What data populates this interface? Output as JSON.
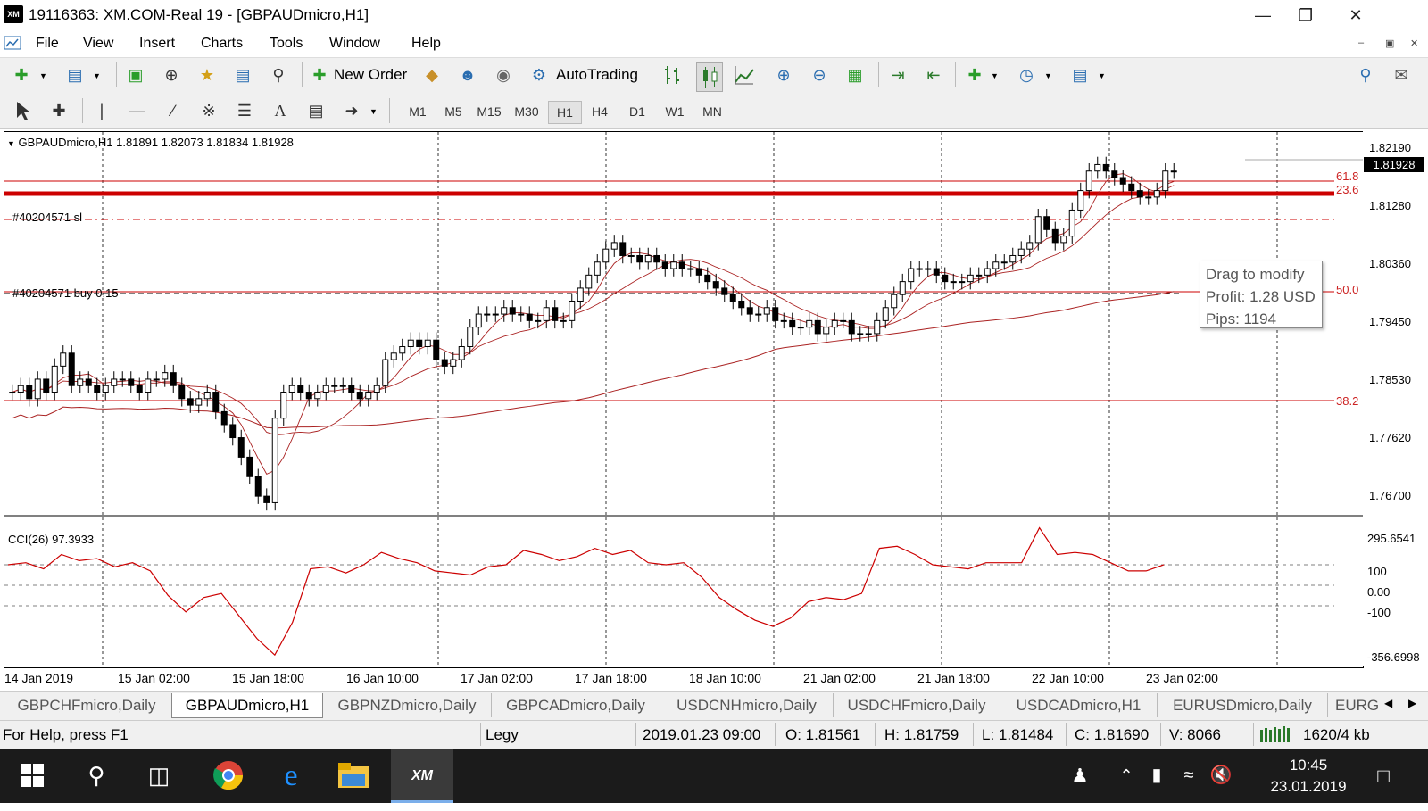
{
  "window": {
    "title": "19116363: XM.COM-Real 19 - [GBPAUDmicro,H1]",
    "app_icon_text": "XM"
  },
  "menu": [
    "File",
    "View",
    "Insert",
    "Charts",
    "Tools",
    "Window",
    "Help"
  ],
  "toolbar": {
    "new_order_label": "New Order",
    "autotrading_label": "AutoTrading"
  },
  "timeframes": [
    "M1",
    "M5",
    "M15",
    "M30",
    "H1",
    "H4",
    "D1",
    "W1",
    "MN"
  ],
  "active_timeframe": "H1",
  "chart": {
    "header": "GBPAUDmicro,H1  1.81891 1.82073 1.81834 1.81928",
    "current_price": "1.81928",
    "price_labels": [
      "1.82190",
      "1.81280",
      "1.80360",
      "1.79450",
      "1.78530",
      "1.77620",
      "1.76700"
    ],
    "annotations": {
      "sl_label": "#40204571 sl",
      "buy_label": "#40204571 buy 0.15"
    },
    "fib_levels": [
      "61.8",
      "23.6",
      "50.0",
      "38.2"
    ],
    "tooltip": [
      "Drag to modify",
      "Profit: 1.28 USD",
      "Pips: 1194"
    ],
    "indicator": {
      "label": "CCI(26) 97.3933",
      "axis_labels": [
        "295.6541",
        "100",
        "0.00",
        "-100",
        "-356.6998"
      ]
    },
    "time_labels": [
      "14 Jan 2019",
      "15 Jan 02:00",
      "15 Jan 18:00",
      "16 Jan 10:00",
      "17 Jan 02:00",
      "17 Jan 18:00",
      "18 Jan 10:00",
      "21 Jan 02:00",
      "21 Jan 18:00",
      "22 Jan 10:00",
      "23 Jan 02:00"
    ]
  },
  "chart_data": {
    "type": "candlestick",
    "symbol": "GBPAUDmicro",
    "timeframe": "H1",
    "ohlc_last": {
      "open": 1.81891,
      "high": 1.82073,
      "low": 1.81834,
      "close": 1.81928
    },
    "ylim": [
      1.766,
      1.825
    ],
    "close_series": [
      1.785,
      1.786,
      1.784,
      1.787,
      1.785,
      1.789,
      1.791,
      1.786,
      1.787,
      1.786,
      1.785,
      1.786,
      1.787,
      1.787,
      1.786,
      1.785,
      1.787,
      1.787,
      1.788,
      1.786,
      1.784,
      1.783,
      1.784,
      1.785,
      1.782,
      1.78,
      1.778,
      1.775,
      1.772,
      1.769,
      1.768,
      1.781,
      1.785,
      1.786,
      1.785,
      1.784,
      1.785,
      1.786,
      1.786,
      1.786,
      1.785,
      1.784,
      1.785,
      1.786,
      1.79,
      1.791,
      1.792,
      1.793,
      1.792,
      1.793,
      1.79,
      1.789,
      1.79,
      1.792,
      1.795,
      1.797,
      1.797,
      1.797,
      1.798,
      1.797,
      1.797,
      1.796,
      1.796,
      1.798,
      1.796,
      1.796,
      1.799,
      1.801,
      1.803,
      1.805,
      1.807,
      1.808,
      1.806,
      1.806,
      1.805,
      1.806,
      1.805,
      1.804,
      1.805,
      1.804,
      1.804,
      1.803,
      1.802,
      1.801,
      1.8,
      1.799,
      1.798,
      1.797,
      1.797,
      1.798,
      1.796,
      1.796,
      1.795,
      1.795,
      1.796,
      1.794,
      1.795,
      1.796,
      1.796,
      1.794,
      1.794,
      1.794,
      1.796,
      1.798,
      1.8,
      1.802,
      1.804,
      1.804,
      1.804,
      1.803,
      1.802,
      1.802,
      1.802,
      1.803,
      1.803,
      1.804,
      1.805,
      1.805,
      1.806,
      1.807,
      1.808,
      1.812,
      1.81,
      1.808,
      1.809,
      1.813,
      1.816,
      1.819,
      1.82,
      1.819,
      1.818,
      1.817,
      1.816,
      1.815,
      1.815,
      1.816,
      1.819,
      1.819
    ],
    "cci_series": [
      100,
      110,
      80,
      150,
      120,
      130,
      90,
      110,
      70,
      -50,
      -130,
      -60,
      -40,
      -150,
      -260,
      -340,
      -180,
      80,
      90,
      60,
      100,
      160,
      130,
      110,
      70,
      60,
      50,
      90,
      100,
      170,
      150,
      120,
      140,
      180,
      150,
      170,
      110,
      100,
      110,
      40,
      -60,
      -120,
      -170,
      -200,
      -160,
      -80,
      -60,
      -70,
      -40,
      180,
      190,
      150,
      100,
      90,
      80,
      110,
      110,
      110,
      280,
      150,
      160,
      150,
      110,
      70,
      70,
      100
    ],
    "cci_ylim": [
      -356.6998,
      295.6541
    ]
  },
  "tabs": [
    "GBPCHFmicro,Daily",
    "GBPAUDmicro,H1",
    "GBPNZDmicro,Daily",
    "GBPCADmicro,Daily",
    "USDCNHmicro,Daily",
    "USDCHFmicro,Daily",
    "USDCADmicro,H1",
    "EURUSDmicro,Daily",
    "EURG"
  ],
  "active_tab": "GBPAUDmicro,H1",
  "status": {
    "help": "For Help, press F1",
    "profile": "Legy",
    "datetime": "2019.01.23 09:00",
    "open": "O: 1.81561",
    "high": "H: 1.81759",
    "low": "L: 1.81484",
    "close": "C: 1.81690",
    "volume": "V: 8066",
    "traffic": "1620/4 kb"
  },
  "taskbar": {
    "time": "10:45",
    "date": "23.01.2019"
  },
  "colors": {
    "price_line": "#cc0000",
    "ma_line": "#aa2222",
    "candle": "#000000"
  }
}
